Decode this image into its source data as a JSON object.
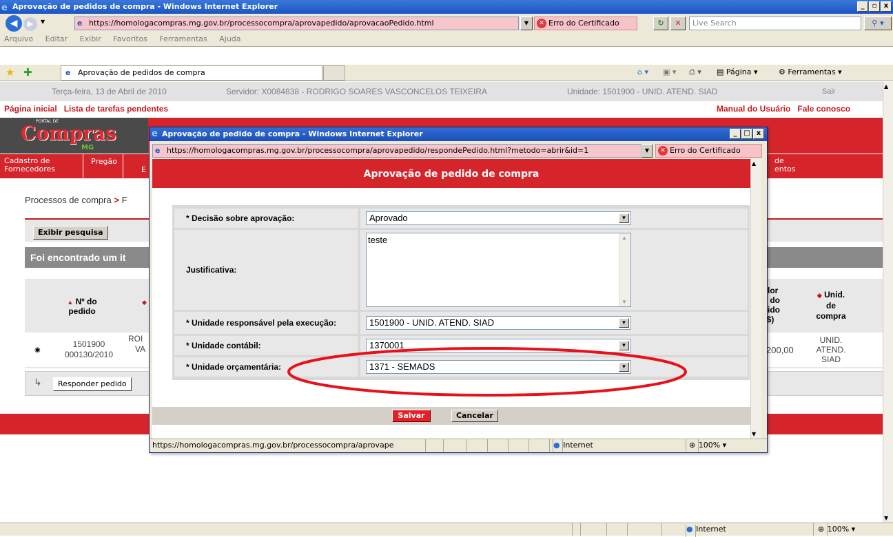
{
  "main_window": {
    "title": "Aprovação de pedidos de compra - Windows Internet Explorer",
    "address": "https://homologacompras.mg.gov.br/processocompra/aprovapedido/aprovacaoPedido.html",
    "cert_error": "Erro do Certificado",
    "search_placeholder": "Live Search",
    "menu": [
      "Arquivo",
      "Editar",
      "Exibir",
      "Favoritos",
      "Ferramentas",
      "Ajuda"
    ],
    "tab_title": "Aprovação de pedidos de compra",
    "cmd_page": "Página",
    "cmd_tools": "Ferramentas",
    "status_zone": "Internet",
    "status_zoom": "100%"
  },
  "site": {
    "topbar": {
      "date": "Terça-feira, 13 de Abril de 2010",
      "server": "Servidor: X0084838 - RODRIGO SOARES VASCONCELOS TEIXEIRA",
      "unit": "Unidade: 1501900 - UNID. ATEND. SIAD",
      "logout": "Sair"
    },
    "links": {
      "home": "Página inicial",
      "pending": "Lista de tarefas pendentes",
      "manual": "Manual do Usuário",
      "contact": "Fale conosco"
    },
    "logo_text": "Compras",
    "logo_sub": "MG",
    "logo_portal": "PORTAL DE",
    "nav": {
      "item1a": "Cadastro de",
      "item1b": "Fornecedores",
      "item2": "Pregão",
      "item3": "E",
      "right1": "de",
      "right2": "entos"
    },
    "breadcrumb": "Processos de compra",
    "breadcrumb_sep": ">",
    "breadcrumb_next": "F",
    "show_search": "Exibir pesquisa",
    "found_text": "Foi encontrado um it",
    "table": {
      "h_order_1": "Nº do",
      "h_order_2": "pedido",
      "h_total_1": "Valor",
      "h_total_2": "tal do",
      "h_total_3": "edido",
      "h_total_4": "(R$)",
      "h_unit_1": "Unid.",
      "h_unit_2": "de",
      "h_unit_3": "compra",
      "row_order_1": "1501900",
      "row_order_2": "000130/2010",
      "row_name_1": "ROI",
      "row_name_2": "VA",
      "row_total": "200,00",
      "row_unit_1": "UNID.",
      "row_unit_2": "ATEND.",
      "row_unit_3": "SIAD"
    },
    "respond_button": "Responder pedido"
  },
  "popup": {
    "title": "Aprovação de pedido de compra - Windows Internet Explorer",
    "address": "https://homologacompras.mg.gov.br/processocompra/aprovapedido/respondePedido.html?metodo=abrir&id=1",
    "cert_error": "Erro do Certificado",
    "header": "Aprovação de pedido de compra",
    "fields": {
      "decision_label": "* Decisão sobre aprovação:",
      "decision_value": "Aprovado",
      "justification_label": "Justificativa:",
      "justification_value": "teste",
      "exec_unit_label": "* Unidade responsável pela execução:",
      "exec_unit_value": "1501900 - UNID. ATEND. SIAD",
      "accounting_label": "* Unidade contábil:",
      "accounting_value": "1370001",
      "budget_label": "* Unidade orçamentária:",
      "budget_value": "1371 - SEMADS"
    },
    "save": "Salvar",
    "cancel": "Cancelar",
    "status_url": "https://homologacompras.mg.gov.br/processocompra/aprovape",
    "status_zone": "Internet",
    "status_zoom": "100%"
  },
  "colors": {
    "accent_red": "#d6242b",
    "highlight_ellipse": "#e8101a"
  }
}
